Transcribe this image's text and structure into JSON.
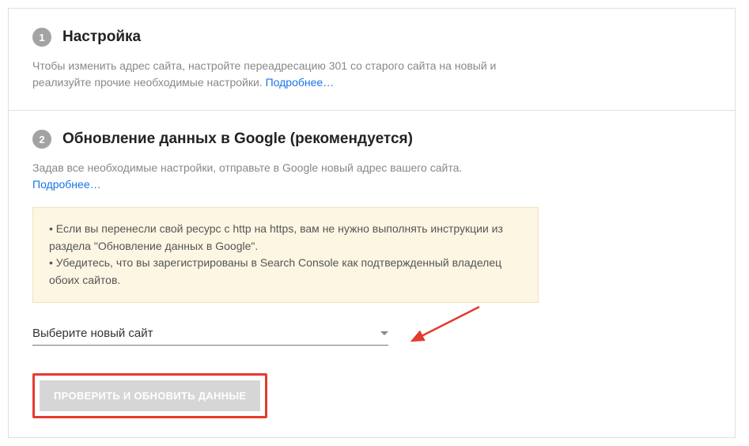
{
  "step1": {
    "number": "1",
    "title": "Настройка",
    "description": "Чтобы изменить адрес сайта, настройте переадресацию 301 со старого сайта на новый и реализуйте прочие необходимые настройки. ",
    "more": "Подробнее…"
  },
  "step2": {
    "number": "2",
    "title": "Обновление данных в Google (рекомендуется)",
    "description": "Задав все необходимые настройки, отправьте в Google новый адрес вашего сайта.",
    "more": "Подробнее…",
    "infoItems": [
      "Если вы перенесли свой ресурс с http на https, вам не нужно выполнять инструкции из раздела \"Обновление данных в Google\".",
      "Убедитесь, что вы зарегистрированы в Search Console как подтвержденный владелец обоих сайтов."
    ],
    "selectPlaceholder": "Выберите новый сайт",
    "submitLabel": "ПРОВЕРИТЬ И ОБНОВИТЬ ДАННЫЕ"
  }
}
